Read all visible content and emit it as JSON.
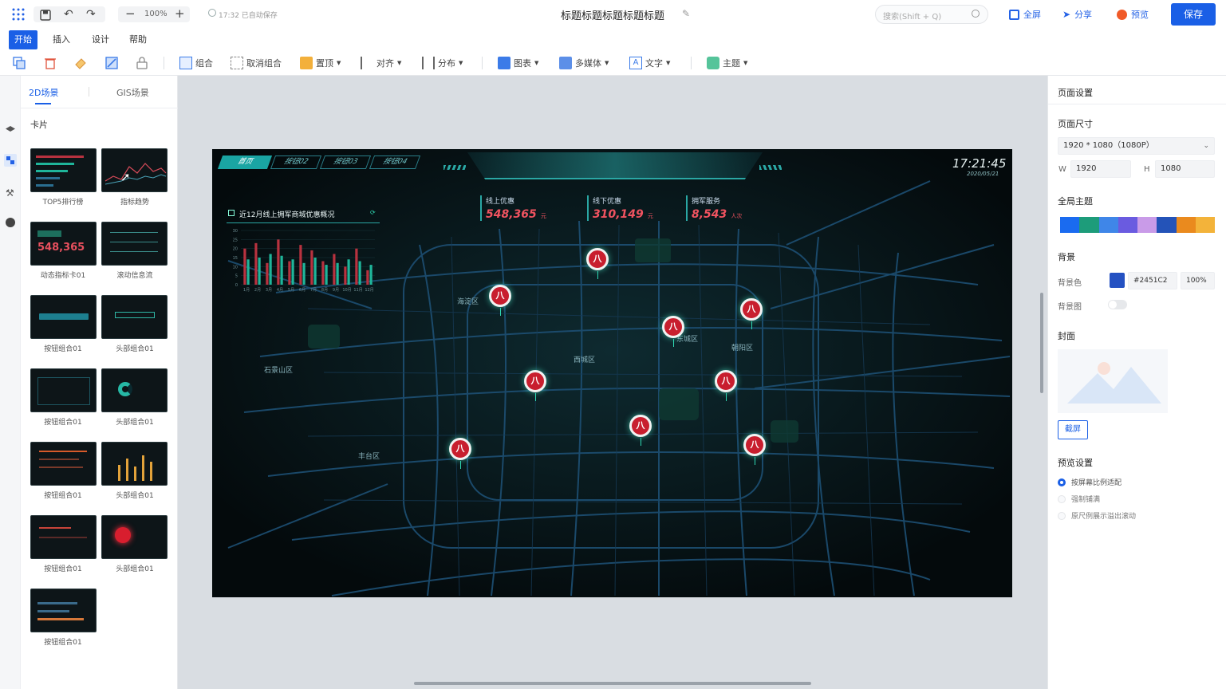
{
  "topbar": {
    "zoom": "100%",
    "autosave": "17:32 已自动保存",
    "doc_title": "标题标题标题标题标题",
    "search_placeholder": "搜索(Shift + Q)",
    "fullscreen": "全屏",
    "share": "分享",
    "preview": "预览",
    "save": "保存"
  },
  "menubar": [
    "开始",
    "插入",
    "设计",
    "帮助"
  ],
  "toolbar": {
    "group": "组合",
    "ungroup": "取消组合",
    "top": "置顶",
    "align": "对齐",
    "distribute": "分布",
    "chart": "图表",
    "media": "多媒体",
    "text": "文字",
    "theme": "主题"
  },
  "leftpanel": {
    "tabs": [
      "2D场景",
      "GIS场景"
    ],
    "section": "卡片",
    "cards": [
      "TOP5排行榜",
      "指标趋势",
      "动态指标卡01",
      "滚动信息流",
      "按钮组合01",
      "头部组合01",
      "按钮组合01",
      "头部组合01",
      "按钮组合01",
      "头部组合01",
      "按钮组合01",
      "头部组合01",
      "按钮组合01"
    ],
    "thumb_card1_value": "548,365"
  },
  "screen": {
    "tabs": [
      "首页",
      "按钮02",
      "按钮03",
      "按钮04"
    ],
    "time": "17:21:45",
    "date": "2020/05/21",
    "panel_title": "近12月线上拥军商城优惠概况",
    "y_ticks": [
      "30",
      "25",
      "20",
      "15",
      "10",
      "5",
      "0"
    ],
    "x_ticks": [
      "1月",
      "2月",
      "3月",
      "4月",
      "5月",
      "6月",
      "7月",
      "8月",
      "9月",
      "10月",
      "11月",
      "12月"
    ],
    "metrics": [
      {
        "label": "线上优惠",
        "value": "548,365",
        "unit": "元"
      },
      {
        "label": "线下优惠",
        "value": "310,149",
        "unit": "元"
      },
      {
        "label": "拥军服务",
        "value": "8,543",
        "unit": "人次"
      }
    ],
    "districts": [
      "海淀区",
      "东城区",
      "朝阳区",
      "西城区",
      "石景山区",
      "丰台区"
    ],
    "pin_glyph": "八"
  },
  "chart_data": {
    "type": "bar",
    "categories": [
      "1月",
      "2月",
      "3月",
      "4月",
      "5月",
      "6月",
      "7月",
      "8月",
      "9月",
      "10月",
      "11月",
      "12月"
    ],
    "series": [
      {
        "values": [
          20,
          23,
          12,
          25,
          13,
          22,
          19,
          13,
          17,
          10,
          20,
          8
        ]
      },
      {
        "values": [
          14,
          15,
          17,
          16,
          14,
          12,
          15,
          11,
          12,
          14,
          13,
          11
        ]
      }
    ],
    "ylim": [
      0,
      30
    ],
    "colors": [
      "#b8323f",
      "#1fb59a"
    ]
  },
  "rightpanel": {
    "title": "页面设置",
    "size_label": "页面尺寸",
    "size_value": "1920 * 1080（1080P）",
    "w_label": "W",
    "w_value": "1920",
    "h_label": "H",
    "h_value": "1080",
    "theme_label": "全局主题",
    "theme_colors": [
      "#1a6bf0",
      "#1d9c7a",
      "#3f86e8",
      "#6a5be0",
      "#c99be8",
      "#2453b8",
      "#ea8a1e",
      "#f3b33a"
    ],
    "bg_label": "背景",
    "bg_color_label": "背景色",
    "bg_color_hex": "#2451C2",
    "bg_opacity": "100%",
    "bg_image_label": "背景图",
    "cover_label": "封面",
    "screenshot_btn": "截屏",
    "preview_label": "预览设置",
    "preview_options": [
      "按屏幕比例适配",
      "强制铺满",
      "原尺例展示溢出滚动"
    ]
  }
}
